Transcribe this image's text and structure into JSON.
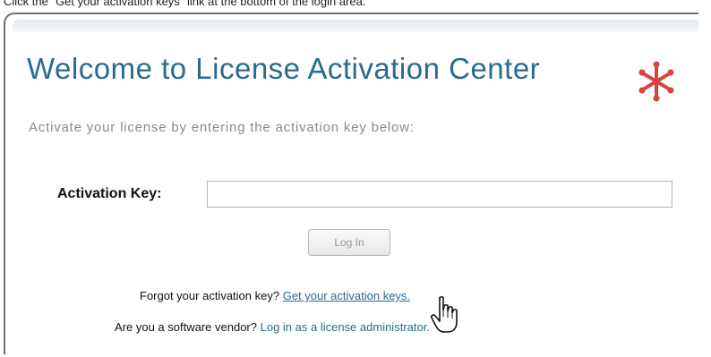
{
  "caption": "Click the \"Get your activation keys\" link at the bottom of the login area.",
  "page": {
    "title": "Welcome to License Activation Center",
    "subtitle": "Activate your license by entering the activation key below:"
  },
  "form": {
    "key_label": "Activation Key:",
    "key_value": "",
    "login_label": "Log In"
  },
  "footer": {
    "forgot_text": "Forgot your activation key?",
    "forgot_link": "Get your activation keys.",
    "vendor_text": "Are you a software vendor?",
    "vendor_link": "Log in as a license administrator."
  },
  "icons": {
    "logo": "asterisk-logo-icon",
    "cursor": "hand-pointer-icon"
  },
  "colors": {
    "title": "#2a6b8c",
    "link": "#2a6b8c",
    "logo": "#d9443f"
  }
}
